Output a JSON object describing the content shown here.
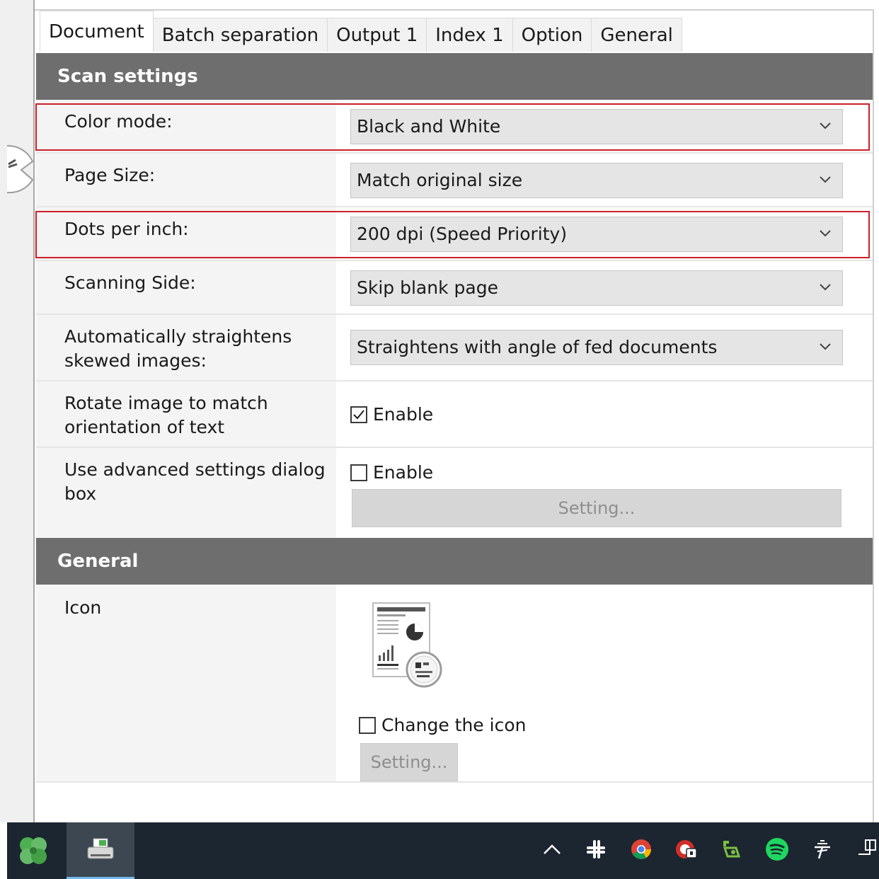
{
  "tabs": [
    {
      "label": "Document",
      "active": true
    },
    {
      "label": "Batch separation",
      "active": false
    },
    {
      "label": "Output 1",
      "active": false
    },
    {
      "label": "Index 1",
      "active": false
    },
    {
      "label": "Option",
      "active": false
    },
    {
      "label": "General",
      "active": false
    }
  ],
  "scan_settings": {
    "header": "Scan settings",
    "color_mode": {
      "label": "Color mode:",
      "value": "Black and White"
    },
    "page_size": {
      "label": "Page Size:",
      "value": "Match original size"
    },
    "dpi": {
      "label": "Dots per inch:",
      "value": "200 dpi (Speed Priority)"
    },
    "scanning_side": {
      "label": "Scanning Side:",
      "value": "Skip blank page"
    },
    "straighten": {
      "label_line1": "Automatically straightens",
      "label_line2": "skewed images:",
      "value": "Straightens with angle of fed documents"
    },
    "rotate": {
      "label_line1": "Rotate image to match",
      "label_line2": "orientation of text",
      "checkbox_label": "Enable",
      "checked": true
    },
    "advanced": {
      "label_line1": "Use advanced settings dialog",
      "label_line2": "box",
      "checkbox_label": "Enable",
      "checked": false,
      "button_label": "Setting..."
    }
  },
  "general": {
    "header": "General",
    "icon_label": "Icon",
    "change_icon_label": "Change the icon",
    "change_icon_checked": false,
    "button_label": "Setting..."
  },
  "highlight_color": "#cc1f2a",
  "taskbar": {
    "start_icon": "clover-icon",
    "active_app_icon": "scanner-app-icon",
    "tray_icons": [
      "chevron-up-icon",
      "slack-icon",
      "chrome-icon",
      "lastpass-icon",
      "green-app-icon",
      "spotify-icon",
      "wifi-icon",
      "network-icon"
    ]
  }
}
